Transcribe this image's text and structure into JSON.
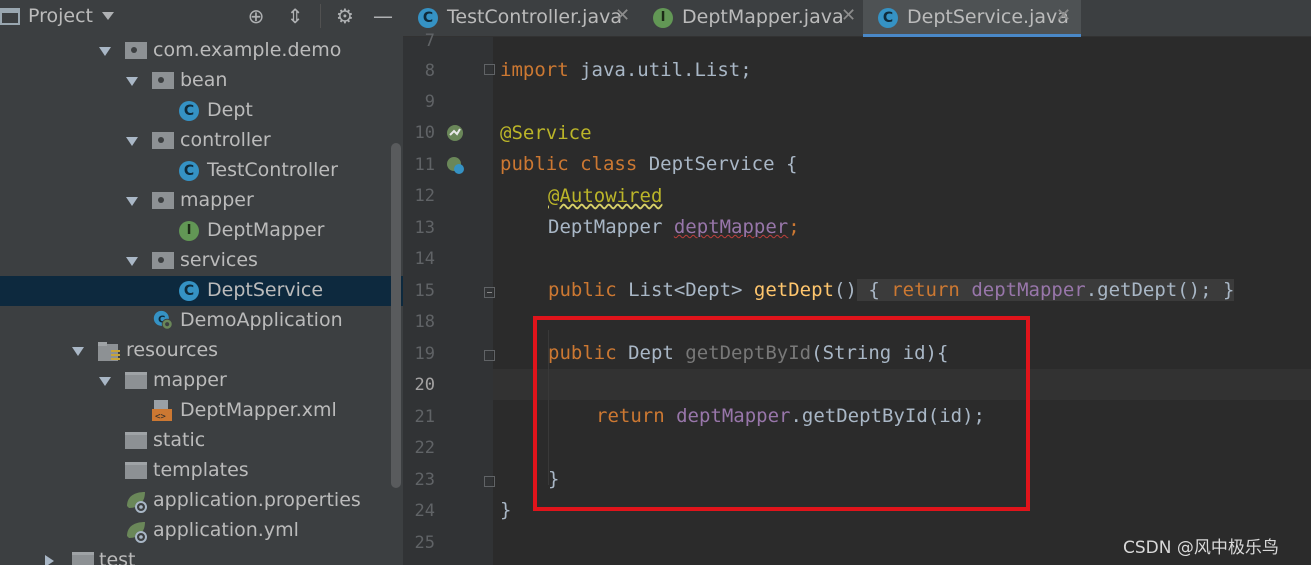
{
  "project_panel": {
    "title": "Project",
    "tree": [
      {
        "label": "com.example.demo",
        "type": "package"
      },
      {
        "label": "bean",
        "type": "package"
      },
      {
        "label": "Dept",
        "type": "class"
      },
      {
        "label": "controller",
        "type": "package"
      },
      {
        "label": "TestController",
        "type": "class"
      },
      {
        "label": "mapper",
        "type": "package"
      },
      {
        "label": "DeptMapper",
        "type": "interface"
      },
      {
        "label": "services",
        "type": "package"
      },
      {
        "label": "DeptService",
        "type": "class",
        "selected": true
      },
      {
        "label": "DemoApplication",
        "type": "spring-class"
      },
      {
        "label": "resources",
        "type": "resources-folder"
      },
      {
        "label": "mapper",
        "type": "folder"
      },
      {
        "label": "DeptMapper.xml",
        "type": "xml"
      },
      {
        "label": "static",
        "type": "folder"
      },
      {
        "label": "templates",
        "type": "folder"
      },
      {
        "label": "application.properties",
        "type": "spring-config"
      },
      {
        "label": "application.yml",
        "type": "spring-config"
      },
      {
        "label": "test",
        "type": "folder"
      }
    ],
    "icons": [
      "project-icon",
      "locate-icon",
      "collapse-all-icon",
      "gear-icon",
      "minimize-icon"
    ]
  },
  "tabs": [
    {
      "label": "TestController.java",
      "icon": "class-icon",
      "active": false
    },
    {
      "label": "DeptMapper.java",
      "icon": "interface-icon",
      "active": false
    },
    {
      "label": "DeptService.java",
      "icon": "class-icon",
      "active": true
    }
  ],
  "editor": {
    "line_numbers": [
      "7",
      "8",
      "9",
      "10",
      "11",
      "12",
      "13",
      "14",
      "15",
      "18",
      "19",
      "20",
      "21",
      "22",
      "23",
      "24",
      "25"
    ],
    "current_line": "20",
    "code": {
      "l8_import": "import",
      "l8_rest": " java.util.List;",
      "l10_ann": "@Service",
      "l11_public": "public",
      "l11_class": "class",
      "l11_name": " DeptService {",
      "l12_ann": "@Autowired",
      "l13_type": "DeptMapper ",
      "l13_field": "deptMapper",
      "l13_semi": ";",
      "l15_public": "public",
      "l15_type": " List<Dept> ",
      "l15_method": "getDept",
      "l15_parens": "()",
      "l15_brace_open": " {",
      "l15_return": "return",
      "l15_field": "deptMapper",
      "l15_call": ".getDept();",
      "l15_brace_close": " }",
      "l19_public": "public",
      "l19_type": " Dept ",
      "l19_method": "getDeptById",
      "l19_params": "(String id){",
      "l21_return": "return",
      "l21_field": "deptMapper",
      "l21_call": ".getDeptById(id);",
      "l23_close": "}",
      "l24_close": "}"
    }
  },
  "colors": {
    "keyword": "#cc7832",
    "annotation": "#bbb529",
    "field": "#9876aa",
    "method": "#ffc66d",
    "plain": "#a9b7c6",
    "highlight_box": "#e0141b"
  },
  "watermark": "CSDN @风中极乐鸟"
}
